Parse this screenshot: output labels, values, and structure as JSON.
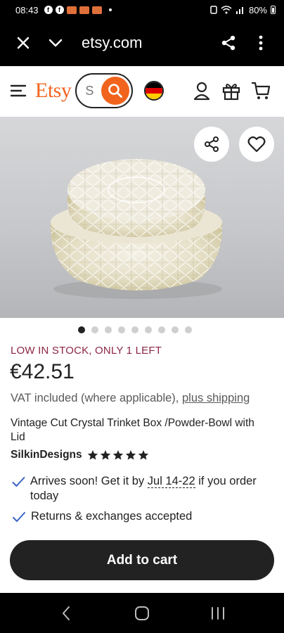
{
  "status_bar": {
    "time": "08:43",
    "battery": "80%"
  },
  "browser": {
    "url": "etsy.com"
  },
  "header": {
    "logo": "Etsy",
    "search_placeholder": "S"
  },
  "carousel": {
    "total_images": 9,
    "active_index": 0
  },
  "product": {
    "stock_notice": "LOW IN STOCK, ONLY 1 LEFT",
    "price": "€42.51",
    "vat_text": "VAT included (where applicable),",
    "shipping_link": "plus shipping",
    "title": "Vintage Cut Crystal Trinket Box /Powder-Bowl with Lid",
    "shop_name": "SilkinDesigns",
    "rating_stars": 5
  },
  "features": {
    "arrival_prefix": "Arrives soon! Get it by",
    "arrival_dates": "Jul 14-22",
    "arrival_suffix": "if you order today",
    "returns": "Returns & exchanges accepted"
  },
  "actions": {
    "add_to_cart": "Add to cart"
  },
  "colors": {
    "accent": "#f1641e",
    "stock": "#8b2543",
    "button": "#222222"
  },
  "icons": [
    "close-icon",
    "chevron-down-icon",
    "share-icon",
    "more-vert-icon",
    "menu-icon",
    "search-icon",
    "germany-flag-icon",
    "user-icon",
    "gift-icon",
    "cart-icon",
    "heart-icon",
    "star-icon",
    "check-icon",
    "back-icon",
    "home-icon",
    "recents-icon"
  ]
}
